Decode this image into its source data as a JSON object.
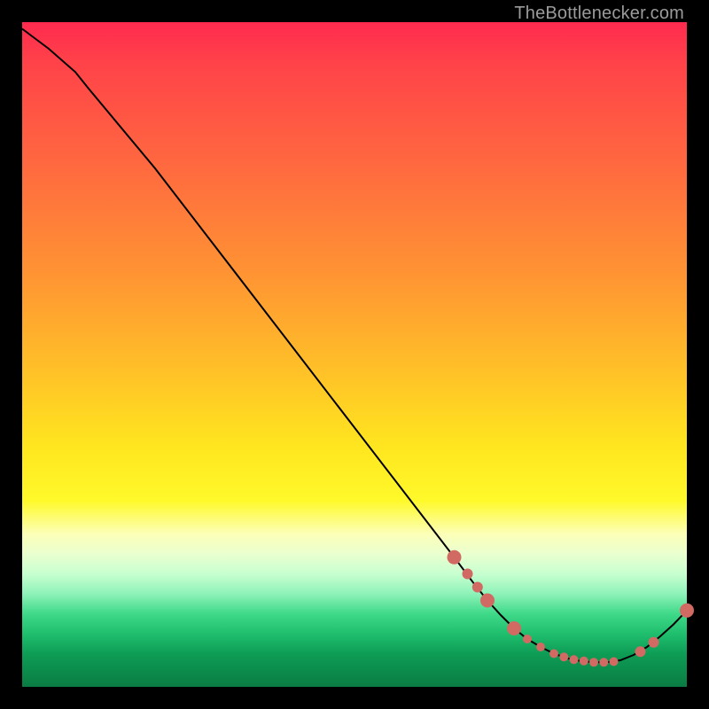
{
  "watermark": "TheBottlenecker.com",
  "colors": {
    "point": "#d16a63",
    "line": "#000000",
    "gradient_stops": [
      "#ff2a4f",
      "#ff6a3f",
      "#ffbf28",
      "#fff92a",
      "#c8ffd0",
      "#1fbf6e",
      "#0a7c43"
    ]
  },
  "chart_data": {
    "type": "line",
    "title": "",
    "xlabel": "",
    "ylabel": "",
    "xlim": [
      0,
      100
    ],
    "ylim": [
      0,
      100
    ],
    "grid": false,
    "legend": false,
    "x": [
      0,
      4,
      8,
      10,
      20,
      30,
      40,
      50,
      60,
      65,
      68,
      70,
      72,
      74,
      76,
      78,
      80,
      82,
      84,
      86,
      88,
      90,
      92,
      94,
      96,
      98,
      100
    ],
    "y": [
      99,
      96,
      92.5,
      90,
      78,
      65,
      52,
      39,
      26,
      19.5,
      15.5,
      13,
      10.8,
      8.8,
      7.2,
      6,
      5,
      4.3,
      3.9,
      3.7,
      3.7,
      4,
      4.8,
      6,
      7.6,
      9.4,
      11.5
    ],
    "highlight_points": {
      "x": [
        65,
        67,
        68.5,
        70,
        74,
        76,
        78,
        80,
        81.5,
        83,
        84.5,
        86,
        87.5,
        89,
        93,
        95,
        100
      ],
      "y": [
        19.5,
        17,
        15,
        13,
        8.8,
        7.2,
        6,
        5,
        4.5,
        4.1,
        3.9,
        3.7,
        3.7,
        3.8,
        5.3,
        6.7,
        11.5
      ],
      "size": [
        "lg",
        "md",
        "md",
        "lg",
        "lg",
        "sm",
        "sm",
        "sm",
        "sm",
        "sm",
        "sm",
        "sm",
        "sm",
        "sm",
        "md",
        "md",
        "lg"
      ]
    },
    "note": "Values read off pixel positions; axes have no tick labels in source image so x/y are nominal 0–100."
  }
}
